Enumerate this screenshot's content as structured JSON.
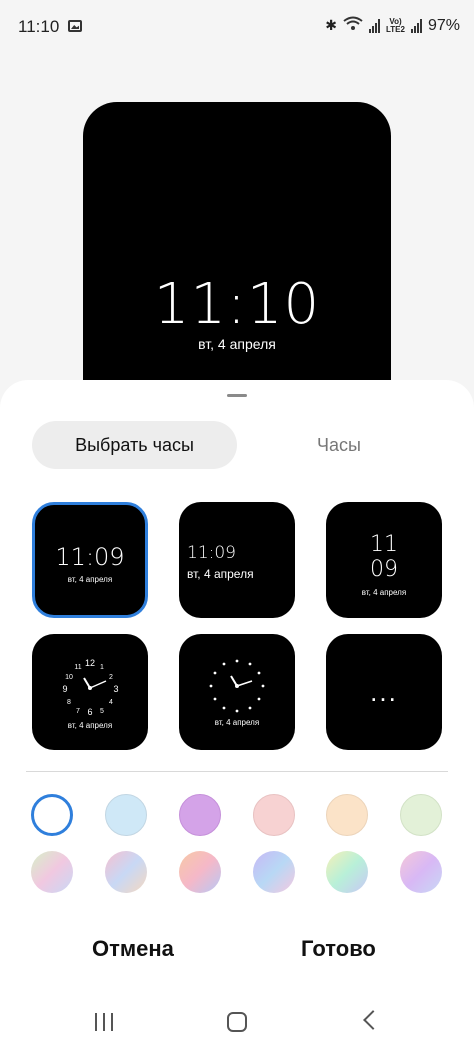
{
  "status_bar": {
    "time": "11:10",
    "lte_top": "Vo)",
    "lte_bottom": "LTE2",
    "battery": "97%"
  },
  "preview": {
    "time": "11:10",
    "date": "вт, 4 апреля"
  },
  "tabs": {
    "active": "Выбрать часы",
    "inactive": "Часы"
  },
  "clock_styles": [
    {
      "time": "11:09",
      "date": "вт, 4 апреля",
      "selected": true
    },
    {
      "time": "11:09",
      "date": "вт, 4 апреля"
    },
    {
      "time_h": "11",
      "time_m": "09",
      "date": "вт, 4 апреля"
    },
    {
      "date": "вт, 4 апреля",
      "numerals": [
        "12",
        "3",
        "6",
        "9"
      ]
    },
    {
      "date": "вт, 4 апреля"
    },
    {
      "more": "..."
    }
  ],
  "colors": [
    {
      "fill": "#ffffff",
      "selected": true,
      "accent": "#2f7fdc"
    },
    {
      "fill": "#cfe8f7"
    },
    {
      "fill": "#d4a3e8"
    },
    {
      "fill": "#f7d2d2"
    },
    {
      "fill": "#fbe3c8"
    },
    {
      "fill": "#e3f1d8"
    },
    {
      "fill": "gradient-mint-pink"
    },
    {
      "fill": "gradient-blue-pink"
    },
    {
      "fill": "gradient-orange-blue"
    },
    {
      "fill": "gradient-purple-blue"
    },
    {
      "fill": "gradient-yellow-blue"
    },
    {
      "fill": "gradient-pink-purple"
    }
  ],
  "actions": {
    "cancel": "Отмена",
    "done": "Готово"
  },
  "navbar": {
    "recent_icon": "recent-apps-icon",
    "home_icon": "home-icon",
    "back_icon": "back-icon"
  }
}
